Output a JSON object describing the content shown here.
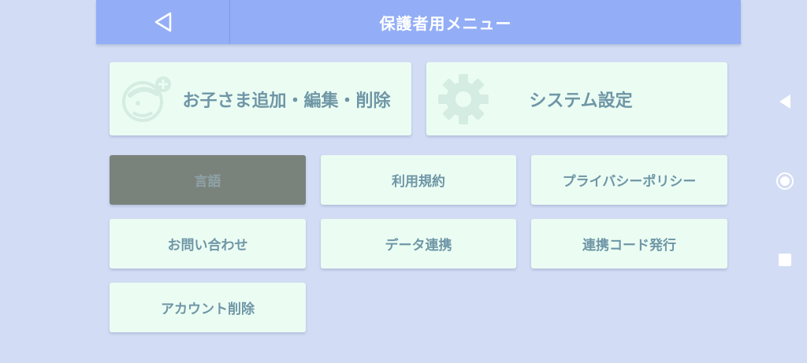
{
  "header": {
    "title": "保護者用メニュー",
    "back_icon": "back-triangle-icon"
  },
  "big_buttons": [
    {
      "label": "お子さま追加・編集・削除",
      "icon": "child-add-icon"
    },
    {
      "label": "システム設定",
      "icon": "gear-icon"
    }
  ],
  "menu": {
    "language": "言語",
    "terms": "利用規約",
    "privacy": "プライバシーポリシー",
    "contact": "お問い合わせ",
    "data_link": "データ連携",
    "link_code": "連携コード発行",
    "delete_account": "アカウント削除"
  },
  "selected_item": "言語",
  "system_nav": [
    "back-icon",
    "home-icon",
    "recents-icon"
  ],
  "colors": {
    "header": "#93aef6",
    "background": "#d2dcf4",
    "card": "#ebfdf3",
    "card_text": "#6f96a6",
    "selected": "#7a827c"
  }
}
